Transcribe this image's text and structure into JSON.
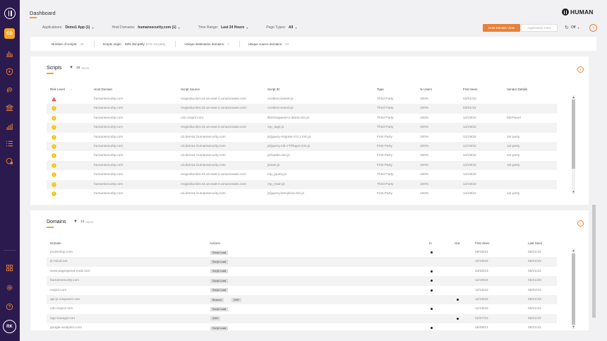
{
  "sidebar": {
    "app_badge": "CD",
    "avatar": "RK",
    "icons": [
      "chart-bar-icon",
      "shield-icon",
      "fingerprint-icon",
      "bank-icon",
      "stats-icon",
      "list-icon",
      "globe-lock-icon",
      "grid-icon",
      "gear-icon",
      "help-icon"
    ]
  },
  "header": {
    "title": "Dashboard",
    "brand": "HUMAN",
    "filters": [
      {
        "label": "Applications:",
        "value": "Demo1 App (1)"
      },
      {
        "label": "Host Domains:",
        "value": "humansecurity.com (1)"
      },
      {
        "label": "Time Range:",
        "value": "Last 24 Hours"
      },
      {
        "label": "Page Types:",
        "value": "All"
      }
    ],
    "host_domain_view": "Host Domain View",
    "application_view": "Application View",
    "refresh": "Off"
  },
  "stats": [
    {
      "label": "Number of scripts:",
      "value": "33",
      "muted": ""
    },
    {
      "label": "Scripts origin:",
      "value": "33% 3rd party",
      "muted": "67% 1st party"
    },
    {
      "label": "Unique destination domains:",
      "value": "3",
      "muted": ""
    },
    {
      "label": "Unique source domains:",
      "value": "10",
      "muted": ""
    }
  ],
  "scripts": {
    "title": "Scripts",
    "count": "33",
    "items_label": "Items",
    "columns": [
      "Risk Level",
      "Host Domain",
      "Script Source",
      "Script ID",
      "Type",
      "% Users",
      "First Seen",
      "Vendor Details"
    ],
    "rows": [
      {
        "risk": "high",
        "host": "humansecurity.com",
        "source": "mvgsxbucket.s3.us-east-2.amazonaws.com",
        "id": "cookieConsent.js",
        "type": "Third Party",
        "users": "100%",
        "first_seen": "02/01/22",
        "vendor": ""
      },
      {
        "risk": "medium",
        "host": "humansecurity.com",
        "source": "mvgsxbucket.s3.us-east-2.amazonaws.com",
        "id": "cookieConsent.js",
        "type": "Third Party",
        "users": "100%",
        "first_seen": "03/01/22",
        "vendor": ""
      },
      {
        "risk": "medium",
        "host": "humansecurity.com",
        "source": "cdn.mxpnl.com",
        "id": "libs/mixpanel-2-latest.min.js",
        "type": "Third Party",
        "users": "100%",
        "first_seen": "12/19/22",
        "vendor": "MixPanel"
      },
      {
        "risk": "medium",
        "host": "humansecurity.com",
        "source": "mvgsxbucket.s3.us-east-2.amazonaws.com",
        "id": "mp_tags.js",
        "type": "Third Party",
        "users": "100%",
        "first_seen": "12/19/22",
        "vendor": ""
      },
      {
        "risk": "medium",
        "host": "humansecurity.com",
        "source": "cd.demo1.humansecurity.com",
        "id": "js/jquery-migrate-3.0.1.min.js",
        "type": "First Party",
        "users": "100%",
        "first_seen": "12/19/22",
        "vendor": "1st party"
      },
      {
        "risk": "medium",
        "host": "humansecurity.com",
        "source": "cd.demo1.humansecurity.com",
        "id": "js/jquery.mb.YTPlayer.min.js",
        "type": "First Party",
        "users": "100%",
        "first_seen": "12/19/22",
        "vendor": "1st party"
      },
      {
        "risk": "medium",
        "host": "humansecurity.com",
        "source": "cd.demo1.humansecurity.com",
        "id": "js/loader.min.js",
        "type": "First Party",
        "users": "100%",
        "first_seen": "12/19/22",
        "vendor": "1st party"
      },
      {
        "risk": "medium",
        "host": "humansecurity.com",
        "source": "cd.demo1.humansecurity.com",
        "id": "js/aos.js",
        "type": "First Party",
        "users": "100%",
        "first_seen": "12/19/22",
        "vendor": "1st party"
      },
      {
        "risk": "medium",
        "host": "humansecurity.com",
        "source": "mvgsxbucket.s3.us-east-2.amazonaws.com",
        "id": "mp_jquery.js",
        "type": "Third Party",
        "users": "100%",
        "first_seen": "12/19/22",
        "vendor": ""
      },
      {
        "risk": "medium",
        "host": "humansecurity.com",
        "source": "mvgsxbucket.s3.us-east-2.amazonaws.com",
        "id": "mp_main.js",
        "type": "Third Party",
        "users": "100%",
        "first_seen": "12/19/22",
        "vendor": ""
      },
      {
        "risk": "medium",
        "host": "humansecurity.com",
        "source": "cd.demo1.humansecurity.com",
        "id": "js/jquery.fancybox.min.js",
        "type": "First Party",
        "users": "100%",
        "first_seen": "12/19/22",
        "vendor": "1st party"
      }
    ]
  },
  "domains": {
    "title": "Domains",
    "count": "13",
    "items_label": "Items",
    "columns": [
      "Domain",
      "Actions",
      "In",
      "Out",
      "First Seen",
      "Last Seen"
    ],
    "rows": [
      {
        "domain": "jscdnshop.com",
        "actions": [
          "Script Load"
        ],
        "in": true,
        "out": false,
        "first_seen": "09/15/21",
        "last_seen": "05/21/23"
      },
      {
        "domain": "js-cloud.net",
        "actions": [
          "Script Load"
        ],
        "in": false,
        "out": false,
        "first_seen": "12/19/22",
        "last_seen": "05/21/23"
      },
      {
        "domain": "www.pagespeed-mod.com",
        "actions": [
          "Script Load"
        ],
        "in": true,
        "out": false,
        "first_seen": "04/28/23",
        "last_seen": "05/21/23"
      },
      {
        "domain": "humansecurity.com",
        "actions": [
          "Script Load"
        ],
        "in": true,
        "out": false,
        "first_seen": "12/19/22",
        "last_seen": "05/21/23"
      },
      {
        "domain": "mxpnl.com",
        "actions": [
          "Script Load"
        ],
        "in": true,
        "out": false,
        "first_seen": "12/19/22",
        "last_seen": "05/02/23"
      },
      {
        "domain": "api-js.mixpanel.com",
        "actions": [
          "Beacon",
          "XHR"
        ],
        "in": false,
        "out": true,
        "first_seen": "12/19/22",
        "last_seen": "05/21/23"
      },
      {
        "domain": "cdn.mxpnl.com",
        "actions": [
          "Script Load"
        ],
        "in": true,
        "out": false,
        "first_seen": "12/19/22",
        "last_seen": "05/21/23"
      },
      {
        "domain": "tag-manager.net",
        "actions": [
          "XHR"
        ],
        "in": false,
        "out": true,
        "first_seen": "02/07/22",
        "last_seen": "05/21/23"
      },
      {
        "domain": "google-analytics.com",
        "actions": [
          "Script Load"
        ],
        "in": true,
        "out": false,
        "first_seen": "06/09/21",
        "last_seen": "05/21/23"
      }
    ]
  },
  "colors": {
    "accent": "#e8813a",
    "sidebar": "#2b1a4e",
    "risk_high": "#d9342b",
    "risk_medium": "#f2c200"
  }
}
